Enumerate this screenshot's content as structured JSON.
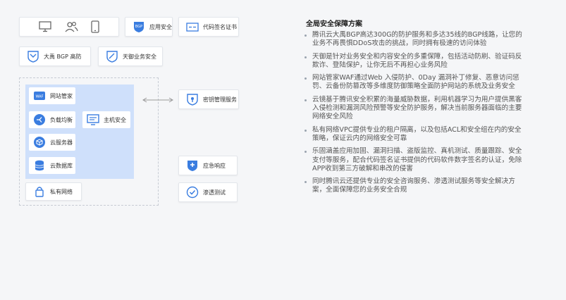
{
  "diagram": {
    "devices": [
      "monitor-icon",
      "users-icon",
      "mobile-icon"
    ],
    "top_services": [
      {
        "icon": "bgp-shield-icon",
        "label": "应用安全"
      },
      {
        "icon": "certificate-icon",
        "label": "代码签名证书"
      }
    ],
    "protection": [
      {
        "icon": "shield-icon",
        "label": "大禹 BGP 高防"
      },
      {
        "icon": "shield-stripe-icon",
        "label": "天御业务安全"
      }
    ],
    "vpc_items": {
      "waf": "网站管家",
      "lb": "负载均衡",
      "cvm": "云服务器",
      "db": "云数据库",
      "host": "主机安全"
    },
    "private_network": "私有网络",
    "kms": "密钥管理服务",
    "emergency": "应急响应",
    "pentest": "渗透测试"
  },
  "panel": {
    "title": "全局安全保障方案",
    "bullets": [
      "腾讯云大禹BGP高达300G的防护服务和多达35线的BGP线路，让您的业务不再畏惧DDoS攻击的挑战，同时拥有极速的访问体验",
      "天御是针对业务安全和内容安全的多重保障，包括活动防刷、验证码反欺诈、登陆保护，让你无后不再担心业务风险",
      "网站管家WAF通过Web 入侵防护、0Day 漏洞补丁修复、恶意访问惩罚、云备份防篡改等多维度防御策略全面防护网站的系统及业务安全",
      "云镜基于腾讯安全积累的海量威胁数据，利用机器学习为用户提供黑客入侵检测和漏洞风险预警等安全防护服务，解决当前服务器面临的主要网络安全风险",
      "私有网络VPC提供专业的租户隔离，以及包括ACL和安全组在内的安全策略，保证云内的网络安全可靠",
      "乐固涵盖应用加固、漏洞扫描、盗版监控、真机测试、质量跟踪、安全支付等服务，配合代码签名证书提供的代码软件数字签名的认证，免除APP收到第三方破解和串改的侵害",
      "同时腾讯云还提供专业的安全咨询服务、渗透测试服务等安全解决方案，全面保障您的业务安全合规"
    ]
  },
  "colors": {
    "accent": "#3a7de0",
    "vpc_bg": "#cfe0fb",
    "text": "#555555"
  }
}
